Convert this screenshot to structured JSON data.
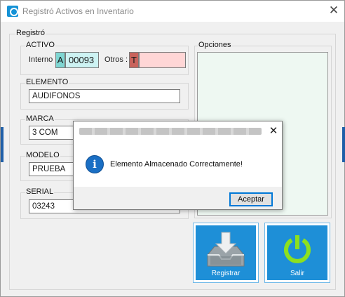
{
  "window": {
    "title": "Registró Activos en Inventario",
    "close_glyph": "✕"
  },
  "form": {
    "group_title": "Registró",
    "activo": {
      "title": "ACTIVO",
      "interno_label": "Interno :",
      "interno_prefix": "A",
      "interno_value": "00093",
      "otros_label": "Otros :",
      "otros_prefix": "T",
      "otros_value": ""
    },
    "elemento": {
      "title": "ELEMENTO",
      "value": "AUDIFONOS"
    },
    "marca": {
      "title": "MARCA",
      "value": "3 COM"
    },
    "modelo": {
      "title": "MODELO",
      "value": "PRUEBA"
    },
    "serial": {
      "title": "SERIAL",
      "value": "03243"
    },
    "opciones": {
      "title": "Opciones"
    }
  },
  "buttons": {
    "registrar": "Registrar",
    "salir": "Salir"
  },
  "dialog": {
    "message": "Elemento Almacenado Correctamente!",
    "info_glyph": "i",
    "close_glyph": "✕",
    "ok_label": "Aceptar"
  },
  "colors": {
    "accent_blue": "#1e8fd7",
    "interno_prefix_bg": "#7fd6d2",
    "interno_value_bg": "#cdf3f3",
    "otros_prefix_bg": "#c9635c",
    "otros_value_bg": "#ffd6d6",
    "opciones_bg": "#eef8f2",
    "info_icon": "#1a6fc4",
    "power_icon": "#8ce01f"
  },
  "icons": {
    "app": "app-icon",
    "registrar": "inbox-download-icon",
    "salir": "power-icon",
    "dialog": "info-icon"
  }
}
